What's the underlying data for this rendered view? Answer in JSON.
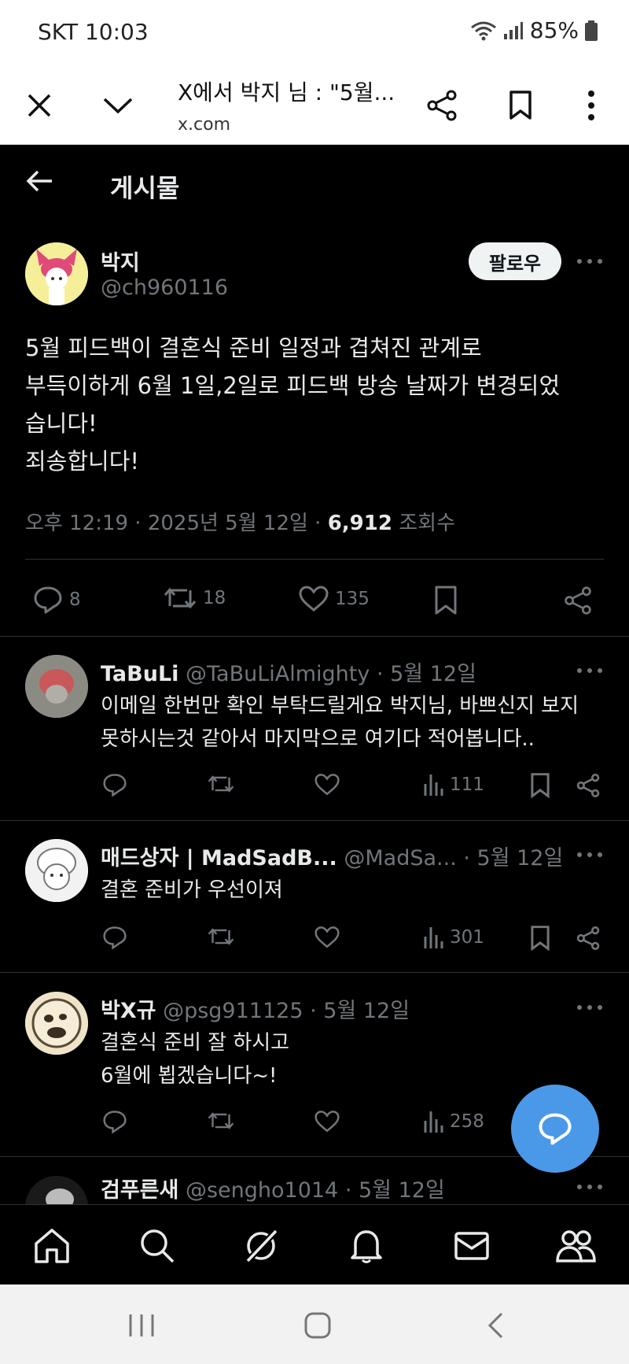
{
  "status_bar": {
    "carrier_time": "SKT 10:03",
    "battery": "85%"
  },
  "browser": {
    "page_title": "X에서 박지 님 : \"5월...",
    "domain": "x.com"
  },
  "header": {
    "title": "게시물"
  },
  "post": {
    "author_name": "박지",
    "author_handle": "@ch960116",
    "follow_label": "팔로우",
    "text_lines": [
      "5월 피드백이 결혼식 준비 일정과 겹쳐진 관계로",
      "부득이하게 6월 1일,2일로 피드백 방송 날짜가 변경되었",
      "습니다!",
      "죄송합니다!"
    ],
    "timestamp": "오후 12:19 · 2025년 5월 12일 · ",
    "views": "6,912",
    "views_label": " 조회수",
    "replies": "8",
    "reposts": "18",
    "likes": "135"
  },
  "replies": [
    {
      "name": "TaBuLi",
      "handle": "@TaBuLiAlmighty",
      "date": " · 5월 12일",
      "lines": [
        "이메일 한번만 확인 부탁드릴게요 박지님, 바쁘신지 보지",
        "못하시는것 같아서 마지막으로 여기다 적어봅니다.."
      ],
      "views": "111"
    },
    {
      "name": "매드상자 | MadSadB...",
      "handle": " @MadSa...",
      "date": " · 5월 12일",
      "lines": [
        "결혼 준비가 우선이져"
      ],
      "views": "301"
    },
    {
      "name": "박X규",
      "handle": " @psg911125",
      "date": " · 5월 12일",
      "lines": [
        "결혼식 준비 잘 하시고",
        "6월에 뵙겠습니다~!"
      ],
      "views": "258"
    },
    {
      "name": "검푸른새",
      "handle": " @sengho1014",
      "date": " · 5월 12일",
      "lines": [],
      "views": ""
    }
  ],
  "colors": {
    "background": "#000000",
    "text": "#e7e9ea",
    "muted": "#71767b",
    "fab": "#4a99e9"
  }
}
